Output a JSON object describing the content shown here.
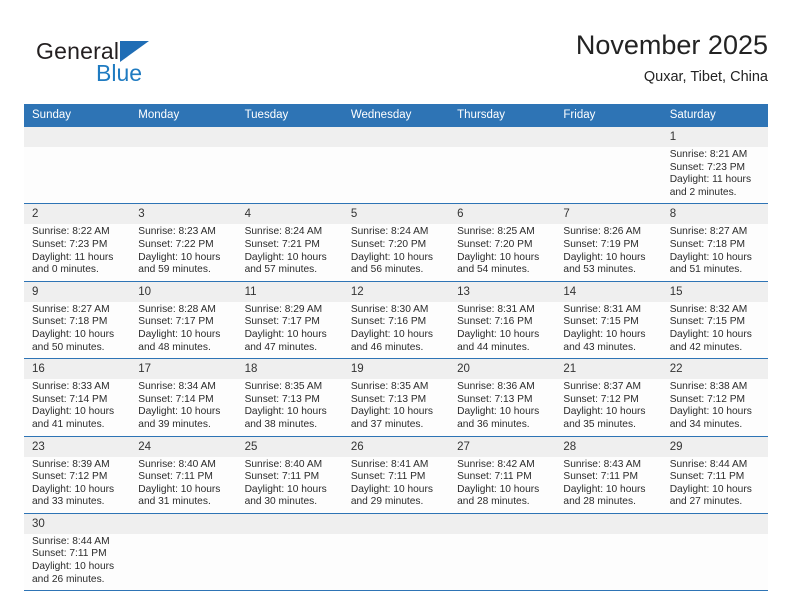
{
  "brand": {
    "name_part1": "General",
    "name_part2": "Blue",
    "triangle_icon": "blue-triangle-icon",
    "accent_color": "#1f7bc1"
  },
  "header": {
    "title": "November 2025",
    "subtitle": "Quxar, Tibet, China"
  },
  "theme": {
    "header_blue": "#2e74b5",
    "daynum_band": "#efefef",
    "row_border": "#2e74b5"
  },
  "calendar": {
    "weekday_headers": [
      "Sunday",
      "Monday",
      "Tuesday",
      "Wednesday",
      "Thursday",
      "Friday",
      "Saturday"
    ],
    "labels": {
      "sunrise": "Sunrise:",
      "sunset": "Sunset:",
      "daylight": "Daylight:"
    },
    "weeks": [
      [
        {
          "day": "",
          "empty": true
        },
        {
          "day": "",
          "empty": true
        },
        {
          "day": "",
          "empty": true
        },
        {
          "day": "",
          "empty": true
        },
        {
          "day": "",
          "empty": true
        },
        {
          "day": "",
          "empty": true
        },
        {
          "day": "1",
          "sunrise": "Sunrise: 8:21 AM",
          "sunset": "Sunset: 7:23 PM",
          "daylight_l1": "Daylight: 11 hours",
          "daylight_l2": "and 2 minutes."
        }
      ],
      [
        {
          "day": "2",
          "sunrise": "Sunrise: 8:22 AM",
          "sunset": "Sunset: 7:23 PM",
          "daylight_l1": "Daylight: 11 hours",
          "daylight_l2": "and 0 minutes."
        },
        {
          "day": "3",
          "sunrise": "Sunrise: 8:23 AM",
          "sunset": "Sunset: 7:22 PM",
          "daylight_l1": "Daylight: 10 hours",
          "daylight_l2": "and 59 minutes."
        },
        {
          "day": "4",
          "sunrise": "Sunrise: 8:24 AM",
          "sunset": "Sunset: 7:21 PM",
          "daylight_l1": "Daylight: 10 hours",
          "daylight_l2": "and 57 minutes."
        },
        {
          "day": "5",
          "sunrise": "Sunrise: 8:24 AM",
          "sunset": "Sunset: 7:20 PM",
          "daylight_l1": "Daylight: 10 hours",
          "daylight_l2": "and 56 minutes."
        },
        {
          "day": "6",
          "sunrise": "Sunrise: 8:25 AM",
          "sunset": "Sunset: 7:20 PM",
          "daylight_l1": "Daylight: 10 hours",
          "daylight_l2": "and 54 minutes."
        },
        {
          "day": "7",
          "sunrise": "Sunrise: 8:26 AM",
          "sunset": "Sunset: 7:19 PM",
          "daylight_l1": "Daylight: 10 hours",
          "daylight_l2": "and 53 minutes."
        },
        {
          "day": "8",
          "sunrise": "Sunrise: 8:27 AM",
          "sunset": "Sunset: 7:18 PM",
          "daylight_l1": "Daylight: 10 hours",
          "daylight_l2": "and 51 minutes."
        }
      ],
      [
        {
          "day": "9",
          "sunrise": "Sunrise: 8:27 AM",
          "sunset": "Sunset: 7:18 PM",
          "daylight_l1": "Daylight: 10 hours",
          "daylight_l2": "and 50 minutes."
        },
        {
          "day": "10",
          "sunrise": "Sunrise: 8:28 AM",
          "sunset": "Sunset: 7:17 PM",
          "daylight_l1": "Daylight: 10 hours",
          "daylight_l2": "and 48 minutes."
        },
        {
          "day": "11",
          "sunrise": "Sunrise: 8:29 AM",
          "sunset": "Sunset: 7:17 PM",
          "daylight_l1": "Daylight: 10 hours",
          "daylight_l2": "and 47 minutes."
        },
        {
          "day": "12",
          "sunrise": "Sunrise: 8:30 AM",
          "sunset": "Sunset: 7:16 PM",
          "daylight_l1": "Daylight: 10 hours",
          "daylight_l2": "and 46 minutes."
        },
        {
          "day": "13",
          "sunrise": "Sunrise: 8:31 AM",
          "sunset": "Sunset: 7:16 PM",
          "daylight_l1": "Daylight: 10 hours",
          "daylight_l2": "and 44 minutes."
        },
        {
          "day": "14",
          "sunrise": "Sunrise: 8:31 AM",
          "sunset": "Sunset: 7:15 PM",
          "daylight_l1": "Daylight: 10 hours",
          "daylight_l2": "and 43 minutes."
        },
        {
          "day": "15",
          "sunrise": "Sunrise: 8:32 AM",
          "sunset": "Sunset: 7:15 PM",
          "daylight_l1": "Daylight: 10 hours",
          "daylight_l2": "and 42 minutes."
        }
      ],
      [
        {
          "day": "16",
          "sunrise": "Sunrise: 8:33 AM",
          "sunset": "Sunset: 7:14 PM",
          "daylight_l1": "Daylight: 10 hours",
          "daylight_l2": "and 41 minutes."
        },
        {
          "day": "17",
          "sunrise": "Sunrise: 8:34 AM",
          "sunset": "Sunset: 7:14 PM",
          "daylight_l1": "Daylight: 10 hours",
          "daylight_l2": "and 39 minutes."
        },
        {
          "day": "18",
          "sunrise": "Sunrise: 8:35 AM",
          "sunset": "Sunset: 7:13 PM",
          "daylight_l1": "Daylight: 10 hours",
          "daylight_l2": "and 38 minutes."
        },
        {
          "day": "19",
          "sunrise": "Sunrise: 8:35 AM",
          "sunset": "Sunset: 7:13 PM",
          "daylight_l1": "Daylight: 10 hours",
          "daylight_l2": "and 37 minutes."
        },
        {
          "day": "20",
          "sunrise": "Sunrise: 8:36 AM",
          "sunset": "Sunset: 7:13 PM",
          "daylight_l1": "Daylight: 10 hours",
          "daylight_l2": "and 36 minutes."
        },
        {
          "day": "21",
          "sunrise": "Sunrise: 8:37 AM",
          "sunset": "Sunset: 7:12 PM",
          "daylight_l1": "Daylight: 10 hours",
          "daylight_l2": "and 35 minutes."
        },
        {
          "day": "22",
          "sunrise": "Sunrise: 8:38 AM",
          "sunset": "Sunset: 7:12 PM",
          "daylight_l1": "Daylight: 10 hours",
          "daylight_l2": "and 34 minutes."
        }
      ],
      [
        {
          "day": "23",
          "sunrise": "Sunrise: 8:39 AM",
          "sunset": "Sunset: 7:12 PM",
          "daylight_l1": "Daylight: 10 hours",
          "daylight_l2": "and 33 minutes."
        },
        {
          "day": "24",
          "sunrise": "Sunrise: 8:40 AM",
          "sunset": "Sunset: 7:11 PM",
          "daylight_l1": "Daylight: 10 hours",
          "daylight_l2": "and 31 minutes."
        },
        {
          "day": "25",
          "sunrise": "Sunrise: 8:40 AM",
          "sunset": "Sunset: 7:11 PM",
          "daylight_l1": "Daylight: 10 hours",
          "daylight_l2": "and 30 minutes."
        },
        {
          "day": "26",
          "sunrise": "Sunrise: 8:41 AM",
          "sunset": "Sunset: 7:11 PM",
          "daylight_l1": "Daylight: 10 hours",
          "daylight_l2": "and 29 minutes."
        },
        {
          "day": "27",
          "sunrise": "Sunrise: 8:42 AM",
          "sunset": "Sunset: 7:11 PM",
          "daylight_l1": "Daylight: 10 hours",
          "daylight_l2": "and 28 minutes."
        },
        {
          "day": "28",
          "sunrise": "Sunrise: 8:43 AM",
          "sunset": "Sunset: 7:11 PM",
          "daylight_l1": "Daylight: 10 hours",
          "daylight_l2": "and 28 minutes."
        },
        {
          "day": "29",
          "sunrise": "Sunrise: 8:44 AM",
          "sunset": "Sunset: 7:11 PM",
          "daylight_l1": "Daylight: 10 hours",
          "daylight_l2": "and 27 minutes."
        }
      ],
      [
        {
          "day": "30",
          "sunrise": "Sunrise: 8:44 AM",
          "sunset": "Sunset: 7:11 PM",
          "daylight_l1": "Daylight: 10 hours",
          "daylight_l2": "and 26 minutes."
        },
        {
          "day": "",
          "empty": true
        },
        {
          "day": "",
          "empty": true
        },
        {
          "day": "",
          "empty": true
        },
        {
          "day": "",
          "empty": true
        },
        {
          "day": "",
          "empty": true
        },
        {
          "day": "",
          "empty": true
        }
      ]
    ]
  }
}
